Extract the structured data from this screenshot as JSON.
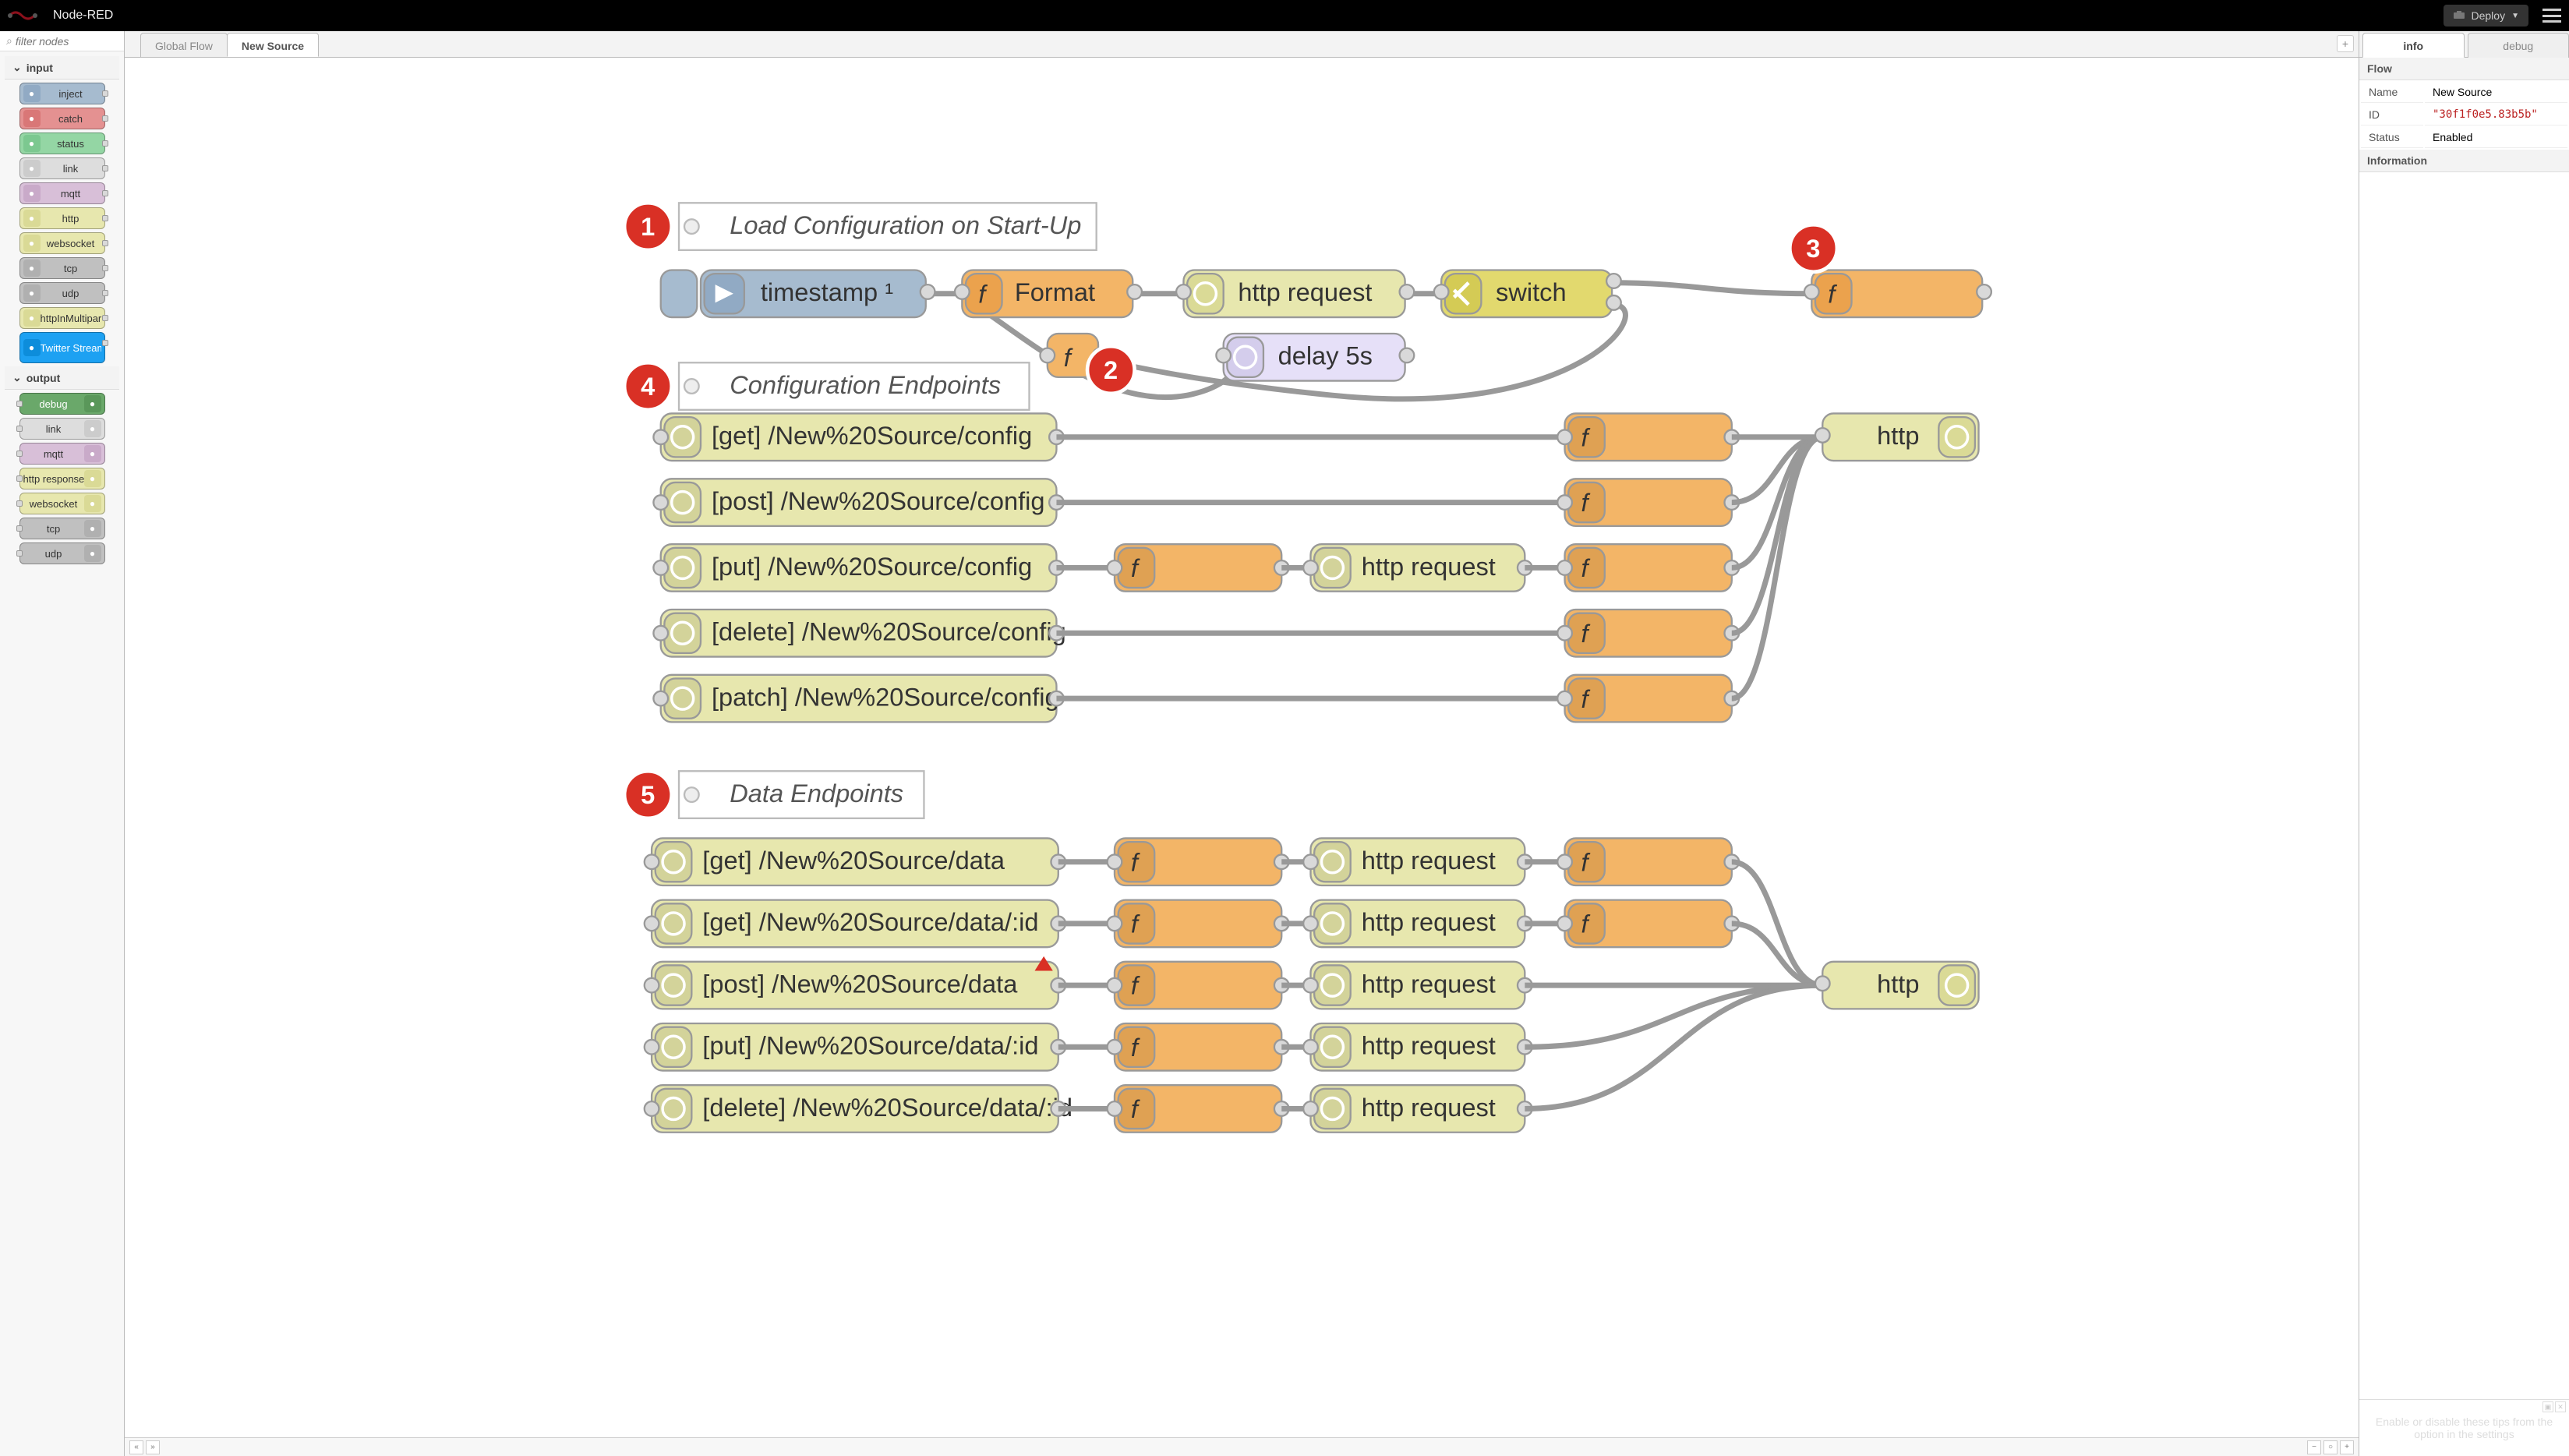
{
  "header": {
    "app_name": "Node-RED",
    "deploy_label": "Deploy",
    "logo_color_a": "#8C101C",
    "logo_color_b": "#555"
  },
  "palette": {
    "filter_placeholder": "filter nodes",
    "categories": {
      "input_label": "input",
      "output_label": "output"
    },
    "input_nodes": [
      {
        "label": "inject",
        "class": "c-inject"
      },
      {
        "label": "catch",
        "class": "c-catch"
      },
      {
        "label": "status",
        "class": "c-status"
      },
      {
        "label": "link",
        "class": "c-link"
      },
      {
        "label": "mqtt",
        "class": "c-mqtt"
      },
      {
        "label": "http",
        "class": "c-http"
      },
      {
        "label": "websocket",
        "class": "c-ws"
      },
      {
        "label": "tcp",
        "class": "c-tcp"
      },
      {
        "label": "udp",
        "class": "c-udp"
      },
      {
        "label": "httpInMultipart",
        "class": "c-httpin"
      },
      {
        "label": "Twitter Stream",
        "class": "c-twitter",
        "tall": true
      }
    ],
    "output_nodes": [
      {
        "label": "debug",
        "class": "c-debug"
      },
      {
        "label": "link",
        "class": "c-link"
      },
      {
        "label": "mqtt",
        "class": "c-mqtt"
      },
      {
        "label": "http response",
        "class": "c-httpresp"
      },
      {
        "label": "websocket",
        "class": "c-ws"
      },
      {
        "label": "tcp",
        "class": "c-tcp"
      },
      {
        "label": "udp",
        "class": "c-udp"
      }
    ]
  },
  "tabs": [
    {
      "label": "Global Flow",
      "active": false
    },
    {
      "label": "New Source",
      "active": true
    }
  ],
  "flow": {
    "comments": {
      "c1": "Load Configuration on Start-Up",
      "c4": "Configuration Endpoints",
      "c5": "Data Endpoints"
    },
    "bubbles": {
      "b1": "1",
      "b2": "2",
      "b3": "3",
      "b4": "4",
      "b5": "5"
    },
    "nodes": {
      "timestamp": "timestamp ¹",
      "format": "Format",
      "httpreq1": "http request",
      "switch": "switch",
      "delay": "delay 5s",
      "cfg_get": "[get] /New%20Source/config",
      "cfg_post": "[post] /New%20Source/config",
      "cfg_put": "[put] /New%20Source/config",
      "cfg_put_httpreq": "http request",
      "cfg_delete": "[delete] /New%20Source/config",
      "cfg_patch": "[patch] /New%20Source/config",
      "cfg_http_out": "http",
      "data_get": "[get] /New%20Source/data",
      "data_get_httpreq": "http request",
      "data_get_id": "[get] /New%20Source/data/:id",
      "data_get_id_httpreq": "http request",
      "data_post": "[post] /New%20Source/data",
      "data_post_httpreq": "http request",
      "data_put": "[put] /New%20Source/data/:id",
      "data_put_httpreq": "http request",
      "data_delete": "[delete] /New%20Source/data/:id",
      "data_delete_httpreq": "http request",
      "data_http_out": "http"
    },
    "colors": {
      "inject": "#a6bbcf",
      "function": "#f3b567",
      "http": "#e7e7ae",
      "switch": "#e2d96e",
      "delay": "#e6e0f8",
      "httpin": "#e7e7ae",
      "httpresp": "#e7e7ae"
    }
  },
  "sidebar": {
    "tabs": {
      "info": "info",
      "debug": "debug"
    },
    "section_flow": "Flow",
    "section_information": "Information",
    "rows": {
      "name_label": "Name",
      "name_value": "New Source",
      "id_label": "ID",
      "id_value": "\"30f1f0e5.83b5b\"",
      "status_label": "Status",
      "status_value": "Enabled"
    },
    "tips": "Enable or disable these tips from the option in the settings"
  }
}
